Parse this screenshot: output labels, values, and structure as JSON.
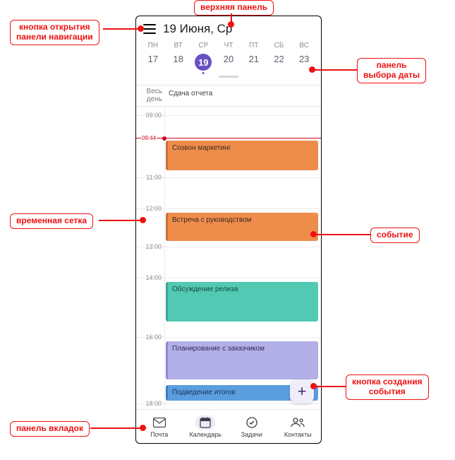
{
  "header": {
    "title": "19 Июня, Ср"
  },
  "week": {
    "dow": [
      "ПН",
      "ВТ",
      "СР",
      "ЧТ",
      "ПТ",
      "СБ",
      "ВС"
    ],
    "days": [
      "17",
      "18",
      "19",
      "20",
      "21",
      "22",
      "23"
    ],
    "selected_index": 2
  },
  "allday": {
    "label": "Весь\nдень",
    "event": "Сдача отчета"
  },
  "hours": [
    "09:00",
    "09:44",
    "11:00",
    "12:00",
    "13:00",
    "14:00",
    "16:00",
    "18:00"
  ],
  "now_label": "09:44",
  "events": {
    "e1": "Созвон маркетинг",
    "e2": "Встреча с руководством",
    "e3": "Обсуждение релиза",
    "e4": "Планирование с заказчиком",
    "e5": "Подведение итогов"
  },
  "fab": {
    "glyph": "+"
  },
  "tabs": {
    "t1": "Почта",
    "t2": "Календарь",
    "t3": "Задачи",
    "t4": "Контакты"
  },
  "annotations": {
    "nav_button": "кнопка открытия\nпанели навигации",
    "top_panel": "верхняя панель",
    "date_panel": "панель\nвыбора даты",
    "time_grid": "временная сетка",
    "event": "событие",
    "create_button": "кнопка создания\nсобытия",
    "tabs_panel": "панель вкладок"
  }
}
